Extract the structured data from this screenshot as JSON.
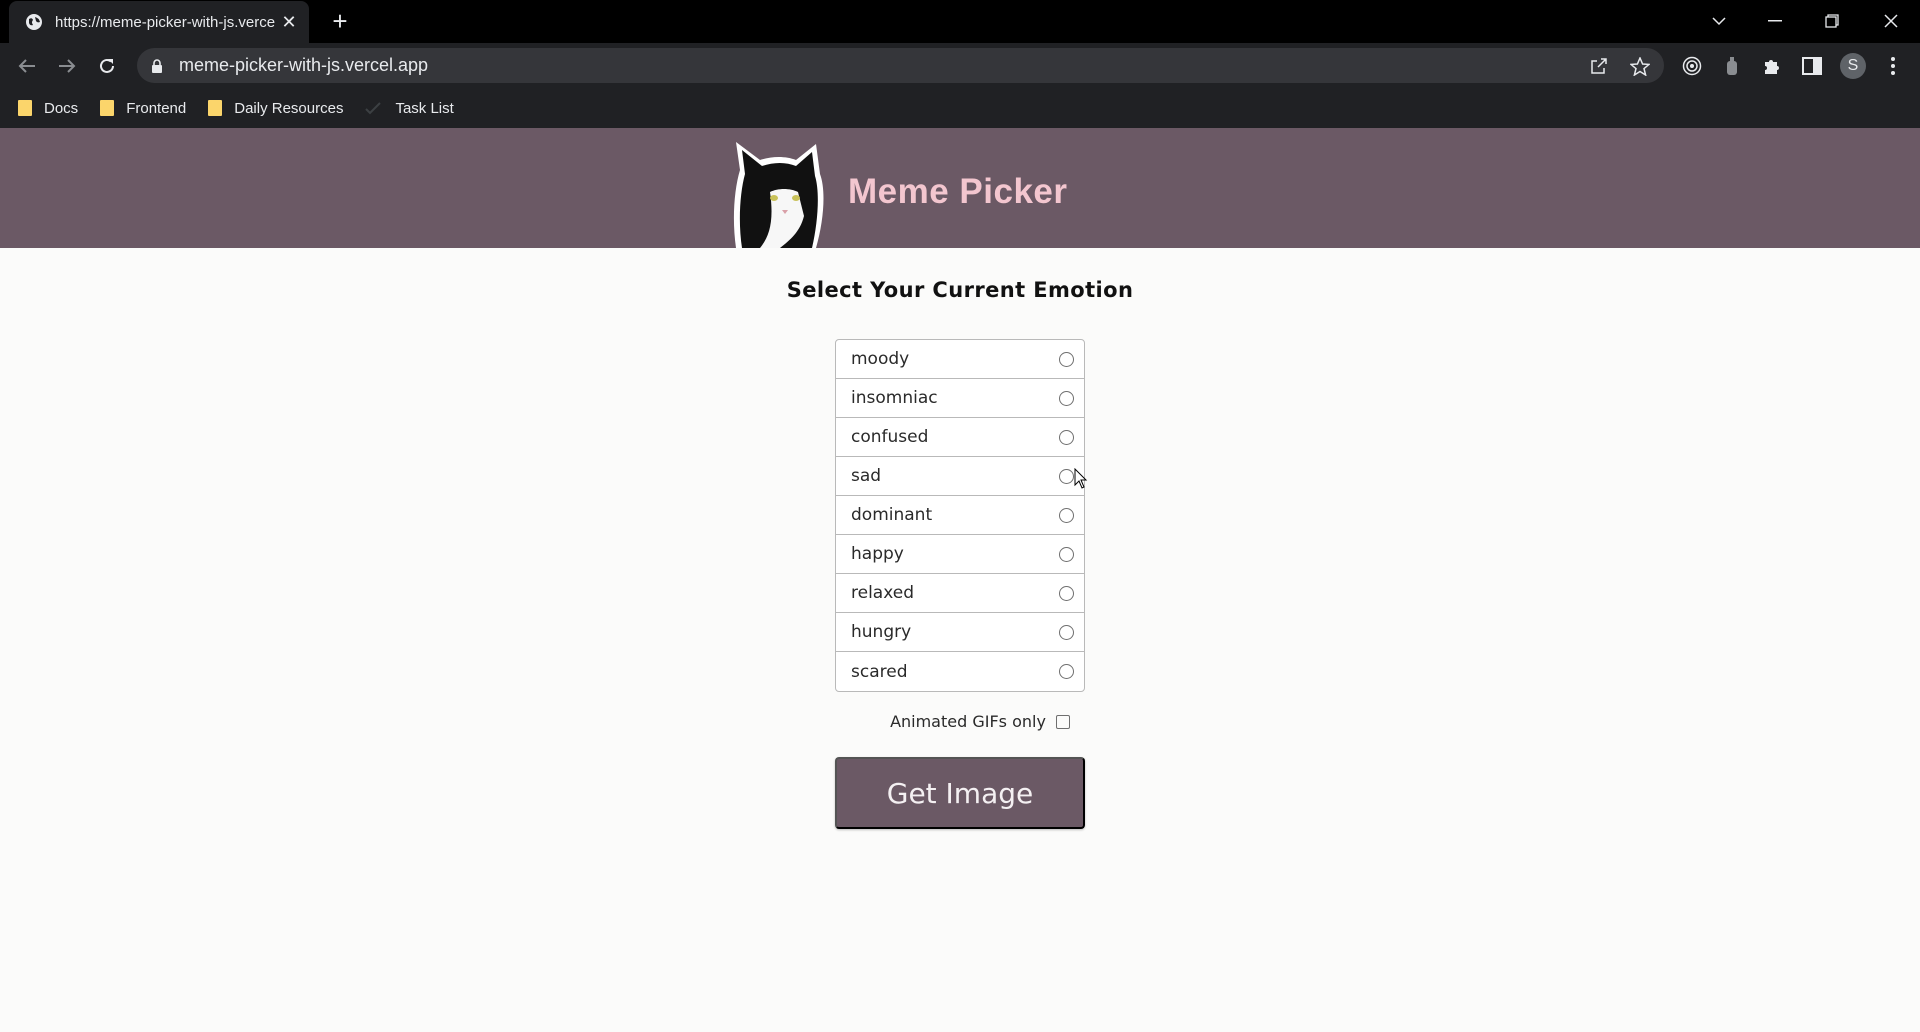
{
  "browser": {
    "tab_title": "https://meme-picker-with-js.vercel.app",
    "url": "meme-picker-with-js.vercel.app",
    "bookmarks": [
      {
        "label": "Docs",
        "icon": "folder-icon"
      },
      {
        "label": "Frontend",
        "icon": "folder-icon"
      },
      {
        "label": "Daily Resources",
        "icon": "folder-icon"
      },
      {
        "label": "Task List",
        "icon": "check-icon"
      }
    ],
    "profile_initial": "S",
    "colors": {
      "tabbar": "#000000",
      "toolbar": "#202124",
      "omnibox": "#35363a",
      "folder": "#fbd56b"
    }
  },
  "site": {
    "title": "Meme Picker",
    "prompt": "Select Your Current Emotion",
    "emotions": [
      "moody",
      "insomniac",
      "confused",
      "sad",
      "dominant",
      "happy",
      "relaxed",
      "hungry",
      "scared"
    ],
    "gif_label": "Animated GIFs only",
    "button_label": "Get Image",
    "colors": {
      "header": "#6b5965",
      "title": "#f3c6cf",
      "button": "#6b5965",
      "background": "#fbfbfa"
    }
  }
}
